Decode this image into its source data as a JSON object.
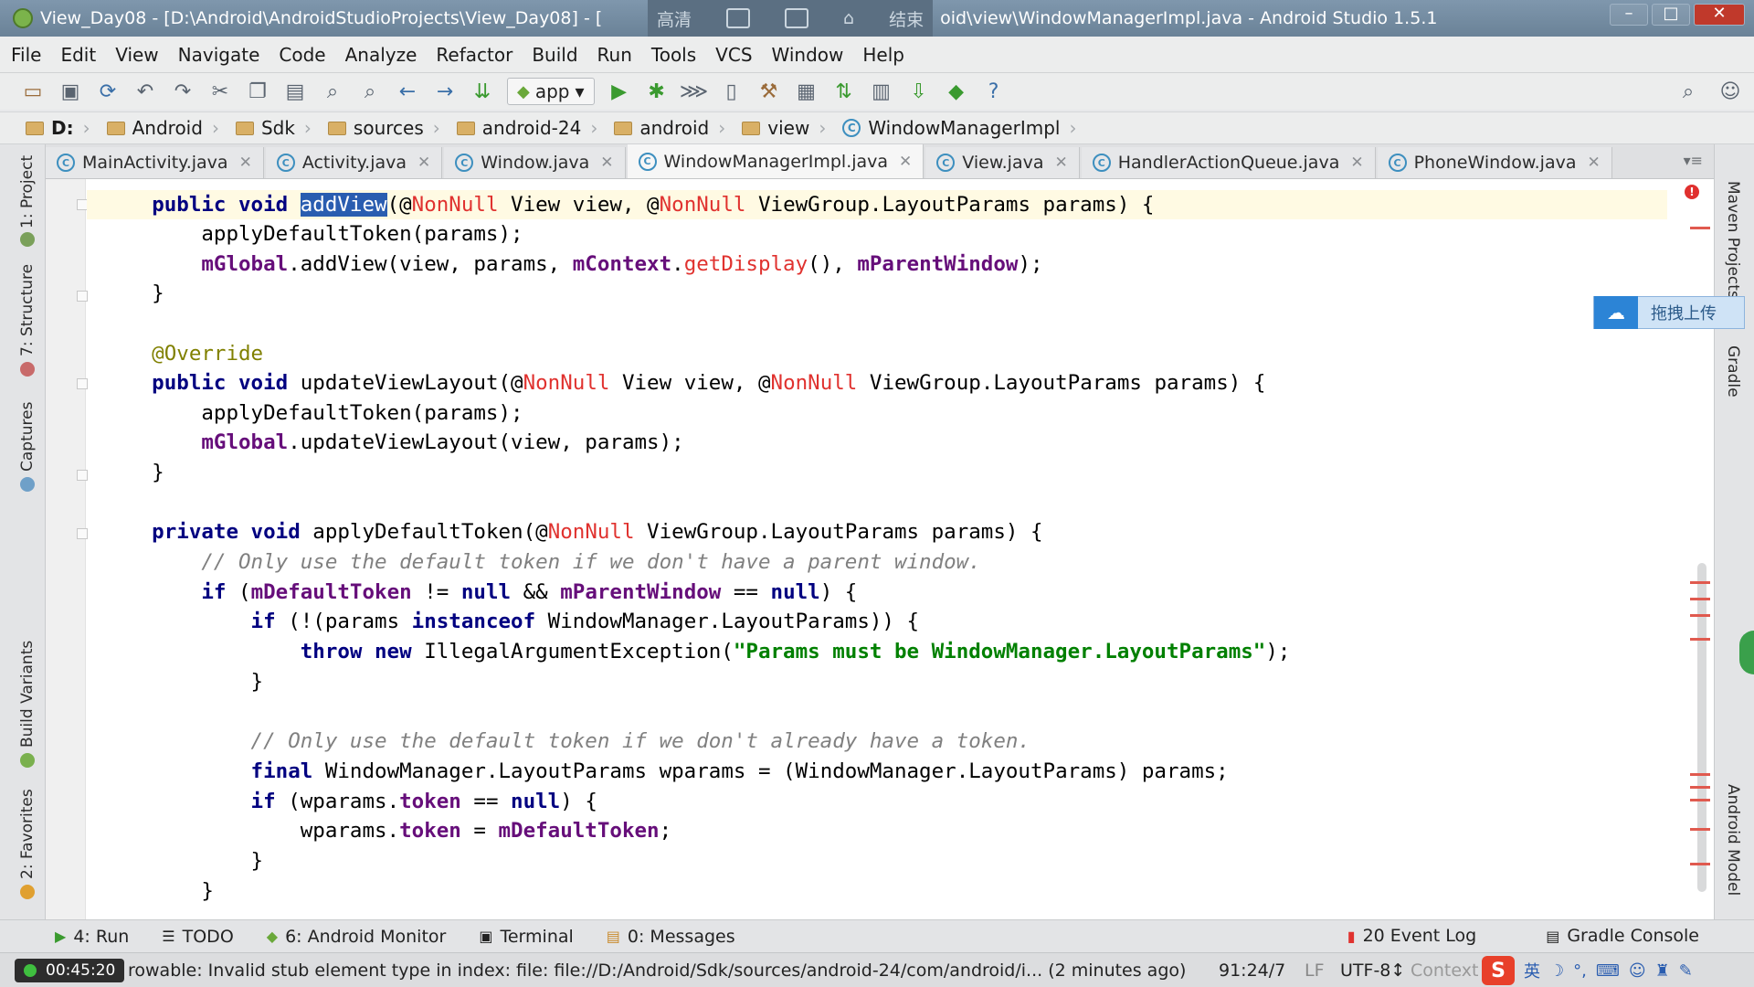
{
  "window": {
    "title_left": "View_Day08 - [D:\\Android\\AndroidStudioProjects\\View_Day08] - [",
    "overlay_hd": "高清",
    "overlay_end": "结束",
    "title_right": "oid\\view\\WindowManagerImpl.java - Android Studio 1.5.1"
  },
  "menu": [
    "File",
    "Edit",
    "View",
    "Navigate",
    "Code",
    "Analyze",
    "Refactor",
    "Build",
    "Run",
    "Tools",
    "VCS",
    "Window",
    "Help"
  ],
  "toolbar": {
    "run_config": "app"
  },
  "breadcrumb": [
    "D:",
    "Android",
    "Sdk",
    "sources",
    "android-24",
    "android",
    "view",
    "WindowManagerImpl"
  ],
  "tabs": [
    {
      "label": "MainActivity.java"
    },
    {
      "label": "Activity.java"
    },
    {
      "label": "Window.java"
    },
    {
      "label": "WindowManagerImpl.java",
      "active": true
    },
    {
      "label": "View.java"
    },
    {
      "label": "HandlerActionQueue.java"
    },
    {
      "label": "PhoneWindow.java"
    }
  ],
  "left_tools": [
    "1: Project",
    "7: Structure",
    "Captures",
    "Build Variants",
    "2: Favorites"
  ],
  "right_tools": [
    "Maven Projects",
    "Gradle",
    "Android Model"
  ],
  "cloud_upload": "拖拽上传",
  "code": {
    "l1_pre": "    ",
    "l1_kw": "public void ",
    "l1_sel": "addView",
    "l1_rest_a": "(@",
    "l1_nn1": "NonNull",
    "l1_rest_b": " View view, @",
    "l1_nn2": "NonNull",
    "l1_rest_c": " ViewGroup.LayoutParams params) {",
    "l2": "        applyDefaultToken(params);",
    "l3_pre": "        ",
    "l3_f1": "mGlobal",
    "l3_a": ".addView(view, params, ",
    "l3_f2": "mContext",
    "l3_b": ".",
    "l3_m": "getDisplay",
    "l3_c": "(), ",
    "l3_f3": "mParentWindow",
    "l3_d": ");",
    "l4": "    }",
    "l5": "    @Override",
    "l6_kw": "    public void ",
    "l6_a": "updateViewLayout(@",
    "l6_nn1": "NonNull",
    "l6_b": " View view, @",
    "l6_nn2": "NonNull",
    "l6_c": " ViewGroup.LayoutParams params) {",
    "l7": "        applyDefaultToken(params);",
    "l8_pre": "        ",
    "l8_f": "mGlobal",
    "l8_a": ".updateViewLayout(view, params);",
    "l9": "    }",
    "l10_kw": "    private void ",
    "l10_a": "applyDefaultToken(@",
    "l10_nn": "NonNull",
    "l10_b": " ViewGroup.LayoutParams params) {",
    "l11": "        // Only use the default token if we don't have a parent window.",
    "l12_kw": "        if ",
    "l12_a": "(",
    "l12_f1": "mDefaultToken",
    "l12_b": " != ",
    "l12_kw2": "null",
    "l12_c": " && ",
    "l12_f2": "mParentWindow",
    "l12_d": " == ",
    "l12_kw3": "null",
    "l12_e": ") {",
    "l13_kw": "            if ",
    "l13_a": "(!(params ",
    "l13_kw2": "instanceof",
    "l13_b": " WindowManager.LayoutParams)) {",
    "l14_kw": "                throw new ",
    "l14_a": "IllegalArgumentException(",
    "l14_str": "\"Params must be WindowManager.LayoutParams\"",
    "l14_b": ");",
    "l15": "            }",
    "l16": "            // Only use the default token if we don't already have a token.",
    "l17_kw": "            final ",
    "l17_a": "WindowManager.LayoutParams wparams = (WindowManager.LayoutParams) params;",
    "l18_kw": "            if ",
    "l18_a": "(wparams.",
    "l18_f": "token",
    "l18_b": " == ",
    "l18_kw2": "null",
    "l18_c": ") {",
    "l19_pre": "                wparams.",
    "l19_f1": "token",
    "l19_a": " = ",
    "l19_f2": "mDefaultToken",
    "l19_b": ";",
    "l20": "            }",
    "l21": "        }"
  },
  "bottom_tools": [
    {
      "label": "4: Run"
    },
    {
      "label": "TODO"
    },
    {
      "label": "6: Android Monitor"
    },
    {
      "label": "Terminal"
    },
    {
      "label": "0: Messages"
    }
  ],
  "bottom_right": {
    "event_count": "20",
    "event_log": "Event Log",
    "gradle_console": "Gradle Console"
  },
  "status": {
    "timer": "00:45:20",
    "message": "rowable: Invalid stub element type in index: file: file://D:/Android/Sdk/sources/android-24/com/android/i... (2 minutes ago)",
    "position": "91:24/7",
    "line_sep": "LF",
    "encoding": "UTF-8↕",
    "context": "Context",
    "ime": "英"
  },
  "colors": {
    "keyword": "#000080",
    "annotation": "#808000",
    "field": "#660e7a",
    "string": "#008000",
    "comment": "#808080",
    "error": "#e0322f"
  }
}
